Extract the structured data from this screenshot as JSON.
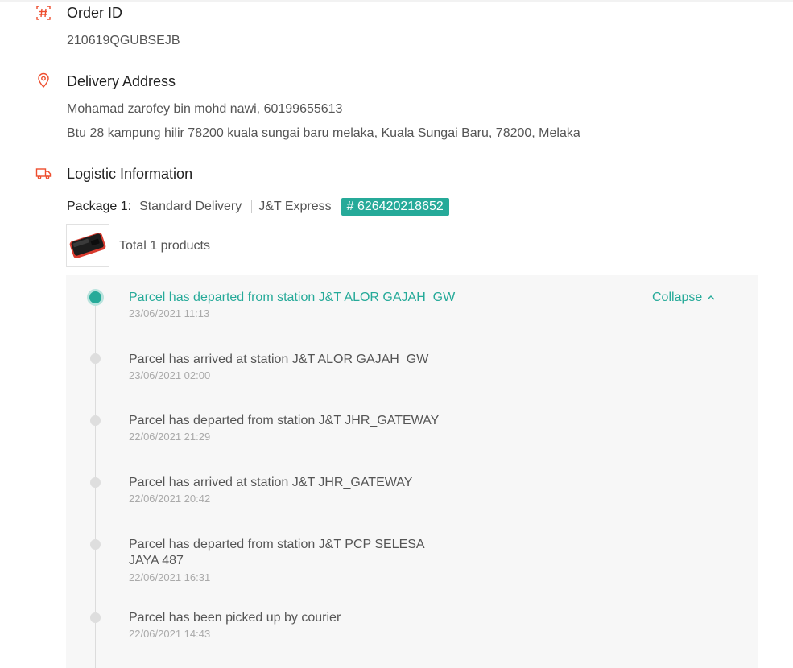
{
  "colors": {
    "accent": "#26aa99",
    "icon": "#ee4d2d"
  },
  "order": {
    "icon": "order-id-icon",
    "title": "Order ID",
    "value": "210619QGUBSEJB"
  },
  "address": {
    "icon": "location-pin-icon",
    "title": "Delivery Address",
    "name_phone": "Mohamad zarofey bin mohd nawi, 60199655613",
    "line": "Btu 28 kampung hilir 78200 kuala sungai baru melaka, Kuala Sungai Baru, 78200, Melaka"
  },
  "logistic": {
    "icon": "truck-icon",
    "title": "Logistic Information",
    "package_label": "Package 1:",
    "service": "Standard Delivery",
    "courier": "J&T Express",
    "tracking": "# 626420218652",
    "total_products": "Total 1 products",
    "collapse_label": "Collapse",
    "events": [
      {
        "text": "Parcel has departed from station J&T ALOR GAJAH_GW",
        "time": "23/06/2021 11:13"
      },
      {
        "text": "Parcel has arrived at station J&T ALOR GAJAH_GW",
        "time": "23/06/2021 02:00"
      },
      {
        "text": "Parcel has departed from station J&T JHR_GATEWAY",
        "time": "22/06/2021 21:29"
      },
      {
        "text": "Parcel has arrived at station J&T JHR_GATEWAY",
        "time": "22/06/2021 20:42"
      },
      {
        "text": "Parcel has departed from station J&T PCP SELESA JAYA 487",
        "time": "22/06/2021 16:31"
      },
      {
        "text": "Parcel has been picked up by courier",
        "time": "22/06/2021 14:43"
      }
    ]
  }
}
